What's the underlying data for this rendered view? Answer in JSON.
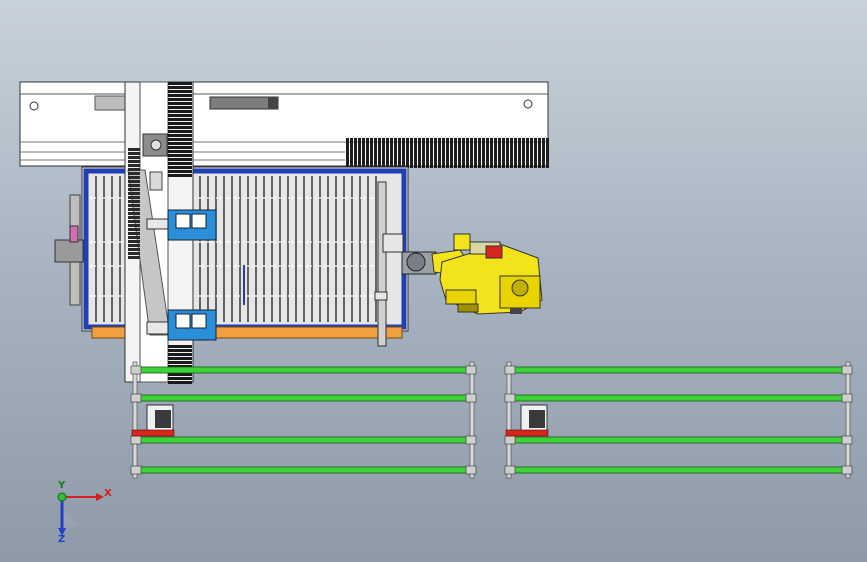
{
  "axes": {
    "x_label": "X",
    "y_label": "Y",
    "z_label": "Z"
  },
  "colors": {
    "frame_blue": "#1f3fb3",
    "robot_yellow": "#f2e31a",
    "conveyor_green": "#3fd13a",
    "stop_red": "#d8261d",
    "base_orange": "#f0a040"
  }
}
